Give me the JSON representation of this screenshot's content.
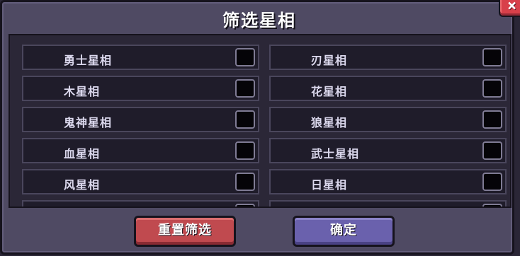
{
  "dialog": {
    "title": "筛选星相",
    "close_label": "×"
  },
  "filters": {
    "left": [
      {
        "label": "勇士星相",
        "checked": false
      },
      {
        "label": "木星相",
        "checked": false
      },
      {
        "label": "鬼神星相",
        "checked": false
      },
      {
        "label": "血星相",
        "checked": false
      },
      {
        "label": "风星相",
        "checked": false
      }
    ],
    "right": [
      {
        "label": "刃星相",
        "checked": false
      },
      {
        "label": "花星相",
        "checked": false
      },
      {
        "label": "狼星相",
        "checked": false
      },
      {
        "label": "武士星相",
        "checked": false
      },
      {
        "label": "日星相",
        "checked": false
      }
    ]
  },
  "buttons": {
    "reset_label": "重置筛选",
    "confirm_label": "确定"
  },
  "colors": {
    "reset_button": "#c04a4f",
    "confirm_button": "#6a61ad",
    "close_button": "#d8404a"
  }
}
